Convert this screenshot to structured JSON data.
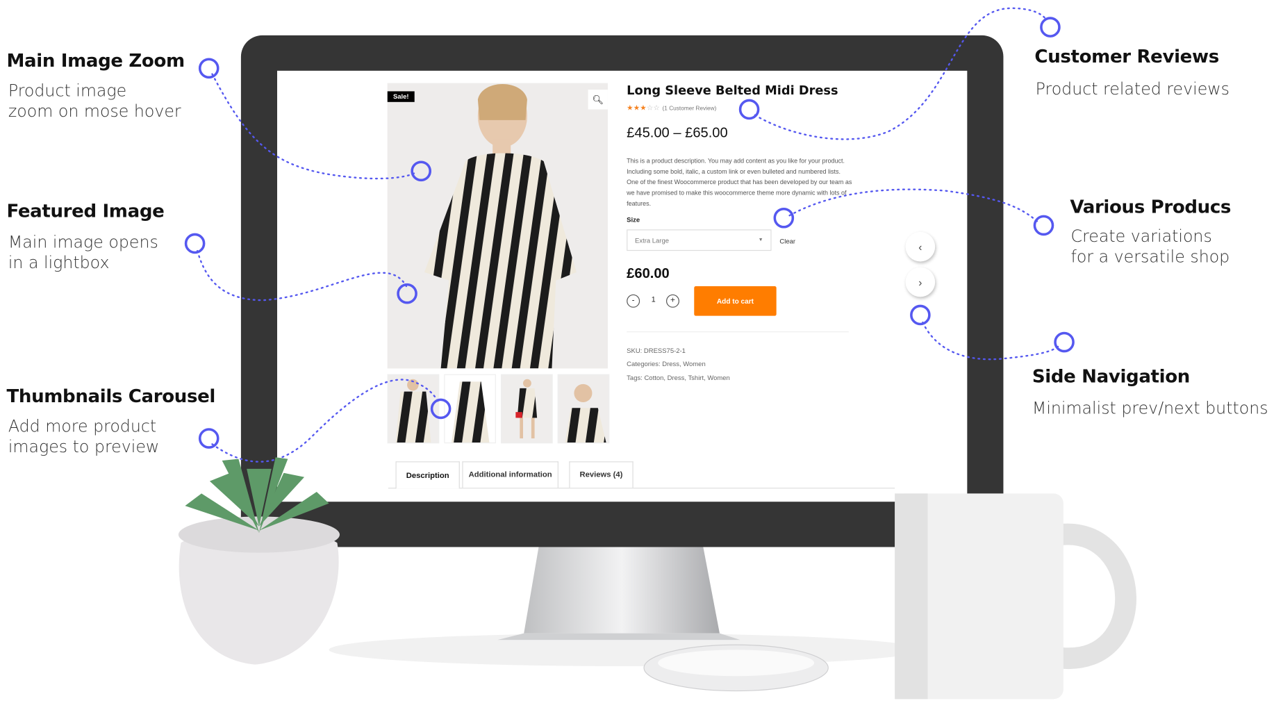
{
  "annotations": {
    "main_image_zoom": {
      "title": "Main Image Zoom",
      "desc": "Product image\nzoom on mose hover"
    },
    "featured_image": {
      "title": "Featured Image",
      "desc": "Main image opens\nin a lightbox"
    },
    "thumbnails_carousel": {
      "title": "Thumbnails Carousel",
      "desc": "Add more product\nimages to preview"
    },
    "customer_reviews": {
      "title": "Customer Reviews",
      "desc": "Product related reviews"
    },
    "various_products": {
      "title": "Various Producs",
      "desc": "Create variations\nfor a versatile shop"
    },
    "side_navigation": {
      "title": "Side Navigation",
      "desc": "Minimalist prev/next buttons"
    },
    "marker_color": "#5558f0"
  },
  "product": {
    "sale_badge": "Sale!",
    "zoom_icon": "magnifier-icon",
    "title": "Long Sleeve Belted Midi Dress",
    "rating": 3,
    "rating_max": 5,
    "review_link": "(1 Customer Review)",
    "price_range": "£45.00 – £65.00",
    "description": "This is a product description. You may add content as you like for your product. Including some bold, italic, a custom link or even bulleted and numbered lists. One of the finest Woocommerce product that has been developed by our team as we have promised to make this woocommerce theme more dynamic with lots of features.",
    "size_label": "Size",
    "size_value": "Extra Large",
    "clear_label": "Clear",
    "variation_price": "£60.00",
    "qty_minus": "-",
    "quantity": "1",
    "qty_plus": "+",
    "add_to_cart": "Add to cart",
    "accent_color": "#ff7d00",
    "sku": "SKU: DRESS75-2-1",
    "categories": "Categories: Dress, Women",
    "tags": "Tags: Cotton, Dress, Tshirt, Women",
    "prev_icon": "‹",
    "next_icon": "›"
  },
  "tabs": [
    {
      "label": "Description",
      "active": true
    },
    {
      "label": "Additional information"
    },
    {
      "label": "Reviews (4)"
    }
  ]
}
